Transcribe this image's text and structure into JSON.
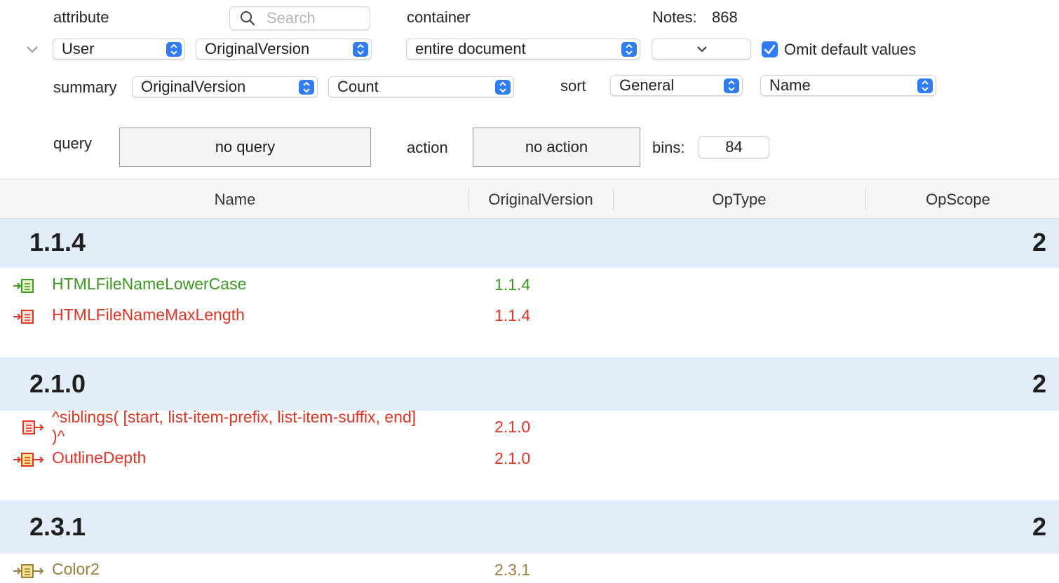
{
  "controls": {
    "attribute_label": "attribute",
    "search_placeholder": "Search",
    "container_label": "container",
    "notes_label": "Notes:",
    "notes_count": "868",
    "attribute_value": "User",
    "attribute_field": "OriginalVersion",
    "container_value": "entire document",
    "omit_default_label": "Omit default values",
    "omit_default_checked": true,
    "summary_label": "summary",
    "summary_field": "OriginalVersion",
    "summary_op": "Count",
    "sort_label": "sort",
    "sort_category": "General",
    "sort_field": "Name",
    "query_label": "query",
    "query_button": "no query",
    "action_label": "action",
    "action_button": "no action",
    "bins_label": "bins:",
    "bins_value": "84"
  },
  "table": {
    "columns": [
      "Name",
      "OriginalVersion",
      "OpType",
      "OpScope"
    ],
    "groups": [
      {
        "name": "1.1.4",
        "count": "2",
        "rows": [
          {
            "name": "HTMLFileNameLowerCase",
            "version": "1.1.4",
            "color": "#3c9a23"
          },
          {
            "name": "HTMLFileNameMaxLength",
            "version": "1.1.4",
            "color": "#e23526"
          }
        ]
      },
      {
        "name": "2.1.0",
        "count": "2",
        "rows": [
          {
            "name": "^siblings( [start, list-item-prefix, list-item-suffix, end] )^",
            "version": "2.1.0",
            "color": "#e23526"
          },
          {
            "name": "OutlineDepth",
            "version": "2.1.0",
            "color": "#e23526"
          }
        ]
      },
      {
        "name": "2.3.1",
        "count": "2",
        "rows": [
          {
            "name": "Color2",
            "version": "2.3.1",
            "color": "#9b7f3e"
          }
        ]
      }
    ]
  },
  "colors": {
    "accent": "#2f7cf6",
    "group_band": "#e3edf9",
    "green": "#3c9a23",
    "red": "#e23526",
    "olive": "#9b7f3e"
  }
}
